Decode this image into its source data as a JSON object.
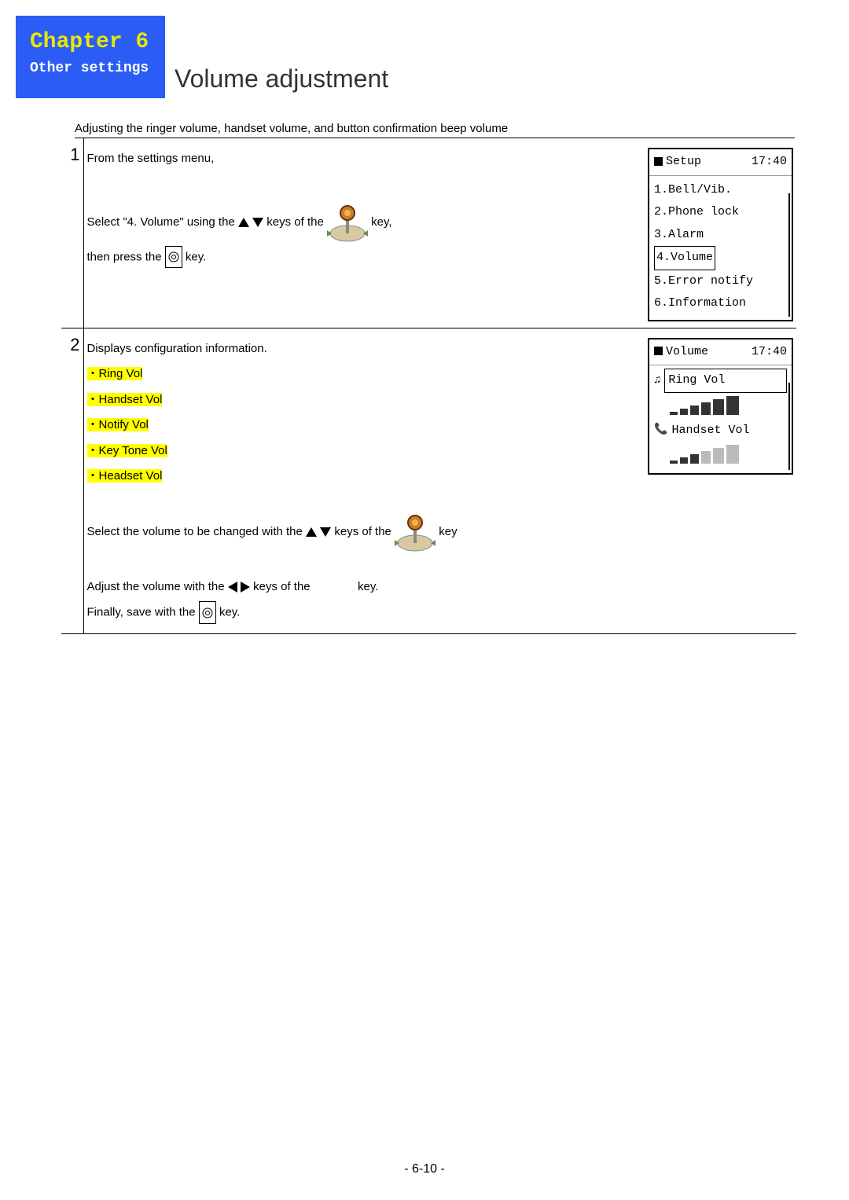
{
  "header": {
    "chapter": "Chapter 6",
    "subtitle": "Other settings"
  },
  "title": "Volume adjustment",
  "intro": "Adjusting the ringer volume, handset volume, and button confirmation beep volume",
  "steps": [
    {
      "num": "1",
      "line1": "From the settings menu,",
      "line2a": "Select \"4. Volume\"  using the ",
      "line2b": " keys of the ",
      "line2c": " key,",
      "line3a": "then press the ",
      "line3b": " key.",
      "screen": {
        "title": "Setup",
        "time": "17:40",
        "items": [
          "1.Bell/Vib.",
          "2.Phone lock",
          "3.Alarm",
          "4.Volume",
          "5.Error notify",
          "6.Information"
        ],
        "selected": 3
      }
    },
    {
      "num": "2",
      "line1": "Displays configuration information.",
      "bullets": [
        "Ring Vol",
        "Handset Vol",
        "Notify Vol",
        "Key Tone Vol",
        "Headset Vol"
      ],
      "line2a": "Select the volume to be changed with the ",
      "line2b": " keys of the ",
      "line2c": " key",
      "line3a": "Adjust the volume with the ",
      "line3b": " keys of the ",
      "line3c": " key.",
      "line4a": "Finally, save with the ",
      "line4b": " key.",
      "screen": {
        "title": "Volume",
        "time": "17:40",
        "row1_label": "Ring Vol",
        "row2_label": "Handset Vol"
      }
    }
  ],
  "footer": "- 6-10 -"
}
